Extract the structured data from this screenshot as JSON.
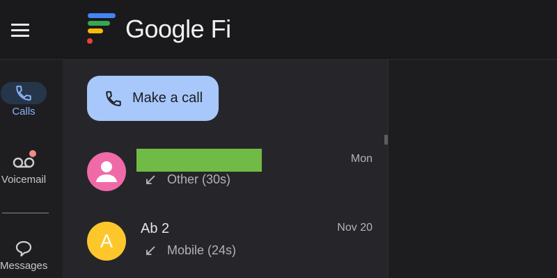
{
  "header": {
    "brand": "Google Fi",
    "menu_icon": "hamburger-menu-icon",
    "logo_icon": "google-fi-logo"
  },
  "nav": {
    "items": [
      {
        "id": "calls",
        "label": "Calls",
        "icon": "phone-icon",
        "active": true
      },
      {
        "id": "voicemail",
        "label": "Voicemail",
        "icon": "voicemail-icon",
        "badge": true
      },
      {
        "id": "messages",
        "label": "Messages",
        "icon": "speech-bubble-icon"
      }
    ]
  },
  "main": {
    "make_call_label": "Make a call",
    "calls": [
      {
        "name": "",
        "redacted": true,
        "type": "Other (30s)",
        "time": "Mon",
        "avatar": "person-icon",
        "direction": "incoming"
      },
      {
        "name": "Ab 2",
        "initial": "A",
        "type": "Mobile (24s)",
        "time": "Nov 20",
        "direction": "incoming"
      }
    ]
  },
  "colors": {
    "accent": "#8ab4f8",
    "cta": "#a8c7fa",
    "avatar_pink": "#f06aa7",
    "avatar_yellow": "#fdc72c",
    "redaction": "#70bb45",
    "badge": "#f28b82"
  }
}
